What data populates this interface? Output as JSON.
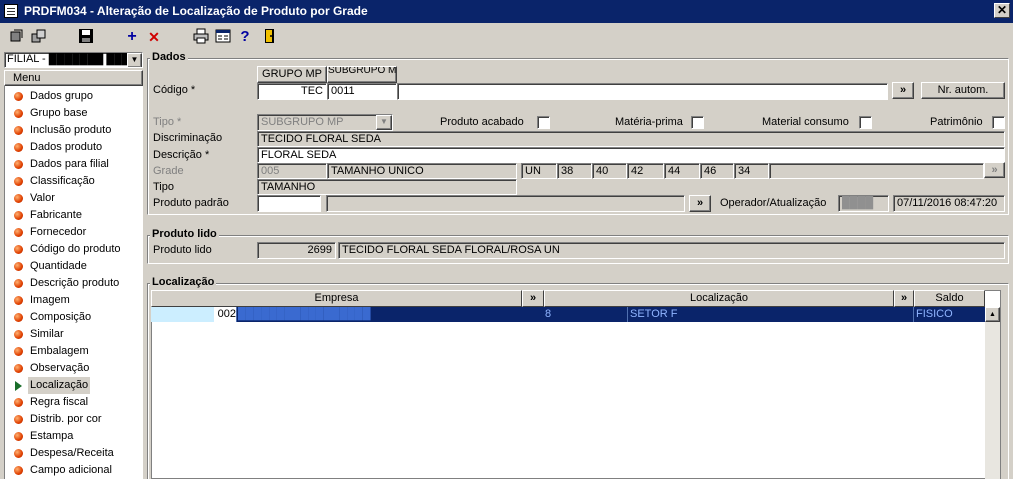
{
  "window": {
    "title": "PRDFM034 - Alteração de Localização de Produto por Grade",
    "close": "✕"
  },
  "toolbar": {
    "icons": [
      "exit-icon",
      "copy-icon",
      "save-icon",
      "add-icon",
      "delete-icon",
      "print-icon",
      "calculator-icon",
      "help-icon",
      "door-icon"
    ],
    "add_glyph": "+",
    "delete_glyph": "✕",
    "help_glyph": "?"
  },
  "sidebar": {
    "branch_select": "FILIAL - ███████ ███",
    "menu_header": "Menu",
    "items": [
      "Dados grupo",
      "Grupo base",
      "Inclusão produto",
      "Dados produto",
      "Dados para filial",
      "Classificação",
      "Valor",
      "Fabricante",
      "Fornecedor",
      "Código do produto",
      "Quantidade",
      "Descrição produto",
      "Imagem",
      "Composição",
      "Similar",
      "Embalagem",
      "Observação",
      "Localização",
      "Regra fiscal",
      "Distrib. por cor",
      "Estampa",
      "Despesa/Receita",
      "Campo adicional"
    ],
    "selected_index": 17
  },
  "dados": {
    "title": "Dados",
    "btn_grupo": "GRUPO MP",
    "btn_subgrupo": "SUBGRUPO MP",
    "codigo_label": "Código *",
    "codigo_grupo": "TEC",
    "codigo_sub": "0011",
    "codigo_extra": "",
    "btn_more": "»",
    "btn_nr_autom": "Nr. autom.",
    "tipo_label": "Tipo *",
    "tipo_value": "SUBGRUPO MP",
    "chk_produto_acabado": "Produto acabado",
    "chk_materia_prima": "Matéria-prima",
    "chk_material_consumo": "Material consumo",
    "chk_patrimonio": "Patrimônio",
    "discriminacao_label": "Discriminação",
    "discriminacao_value": "TECIDO FLORAL SEDA",
    "descricao_label": "Descrição *",
    "descricao_value": "FLORAL SEDA",
    "grade_label": "Grade",
    "grade_code": "005",
    "grade_name": "TAMANHO UNICO",
    "grade_sizes": [
      "UN",
      "38",
      "40",
      "42",
      "44",
      "46",
      "34"
    ],
    "tipo2_label": "Tipo",
    "tipo2_value": "TAMANHO",
    "produto_padrao_label": "Produto padrão",
    "produto_padrao_code": "",
    "produto_padrao_desc": "",
    "operador_label": "Operador/Atualização",
    "operador_value": "████",
    "atualizacao_value": "07/11/2016 08:47:20"
  },
  "produto_lido": {
    "title": "Produto lido",
    "label": "Produto lido",
    "code": "2699",
    "desc": "TECIDO FLORAL SEDA FLORAL/ROSA UN"
  },
  "localizacao": {
    "title": "Localização",
    "columns": {
      "empresa": "Empresa",
      "more1": "»",
      "localizacao": "Localização",
      "more2": "»",
      "saldo": "Saldo"
    },
    "rows": [
      {
        "code": "",
        "empresa_code": "002",
        "empresa_name": "█████████████████",
        "loc_code": "8",
        "loc_name": "SETOR F",
        "saldo": "FISICO"
      }
    ]
  },
  "colors": {
    "title_bar": "#0a246a",
    "selection": "#0a246a",
    "window": "#d4d0c8",
    "bullet": "#e04000"
  }
}
